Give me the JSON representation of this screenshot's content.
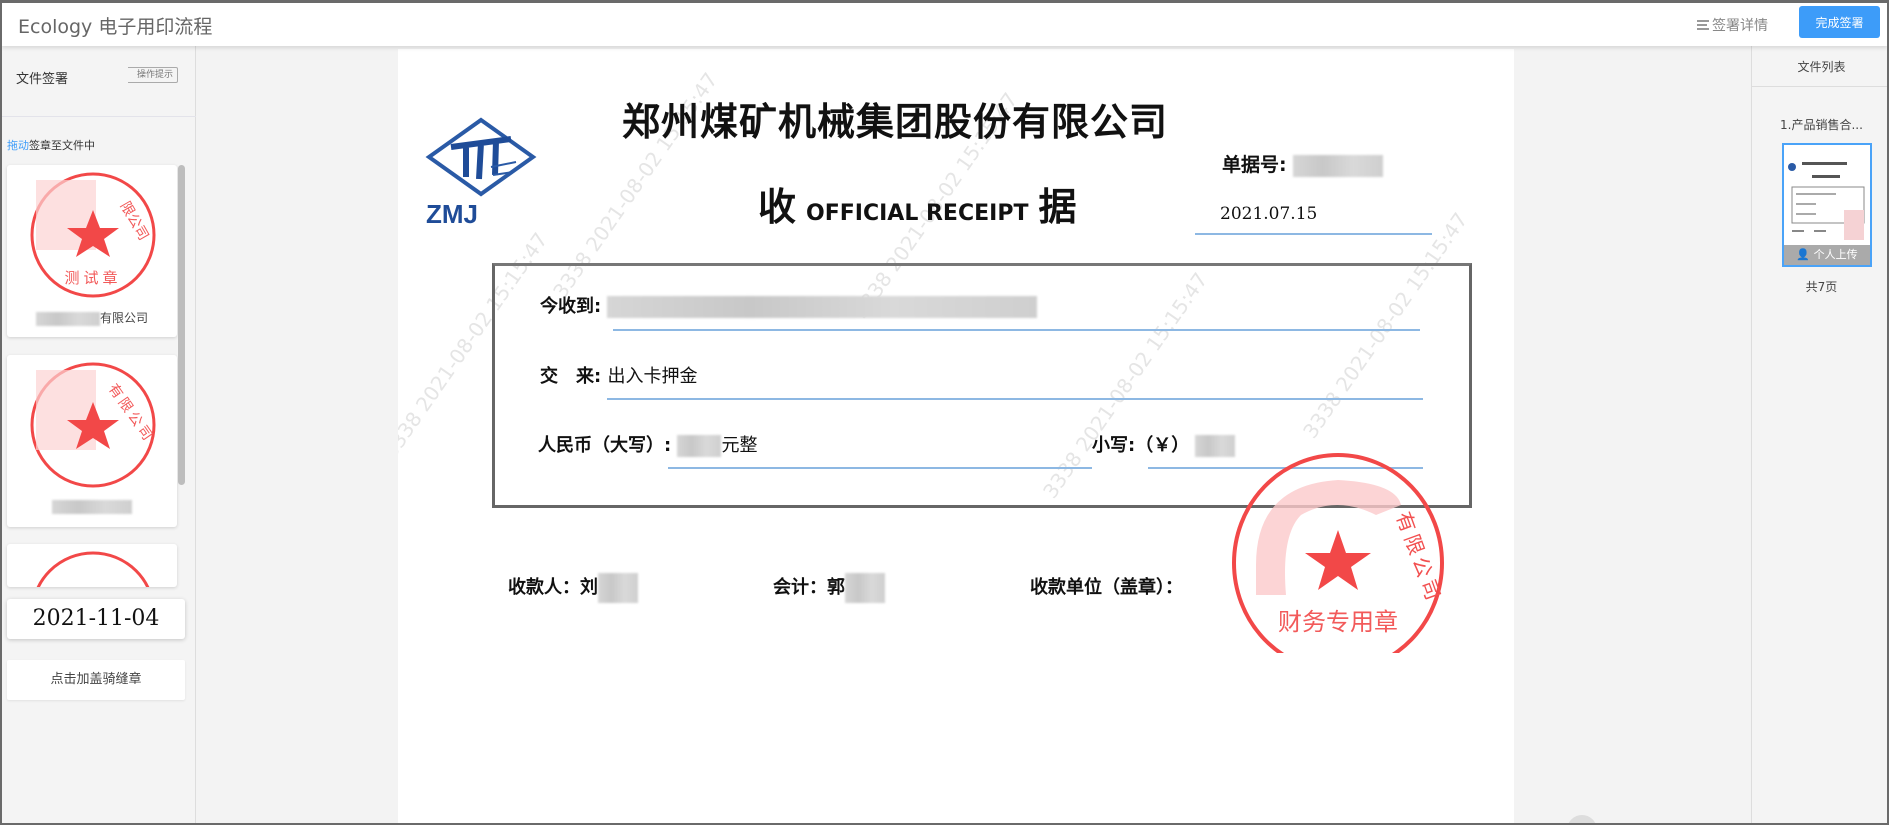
{
  "header": {
    "title": "Ecology 电子用印流程",
    "details_label": "签署详情",
    "finish_label": "完成签署"
  },
  "left_panel": {
    "title": "文件签署",
    "hint_label": "操作提示",
    "drag_tip_link": "拖动",
    "drag_tip_rest": "签章至文件中",
    "stamps": [
      {
        "arc_text": "限公司",
        "center_text": "测试章",
        "label": "有限公司"
      },
      {
        "arc_text": "有限公司",
        "center_text": "",
        "label": ""
      },
      {
        "arc_text": "",
        "center_text": "",
        "label": ""
      }
    ],
    "date_stamp": "2021-11-04",
    "seam_button": "点击加盖骑缝章"
  },
  "document": {
    "company": "郑州煤矿机械集团股份有限公司",
    "logo_text": "ZMJ",
    "receipt_no_label": "单据号:",
    "title_left": "收",
    "title_en": "OFFICIAL RECEIPT",
    "title_right": "据",
    "date": "2021.07.15",
    "received_from_label": "今收到:",
    "for_label": "交　来:",
    "for_value": "出入卡押金",
    "rmb_upper_label": "人民币（大写）:",
    "rmb_upper_suffix": "元整",
    "rmb_lower_label": "小写:（￥）",
    "payee_label": "收款人：刘",
    "accountant_label": "会计：郭",
    "unit_label": "收款单位（盖章）：",
    "seal_arc_text": "有限公司",
    "seal_bottom_text": "财务专用章",
    "watermark": "3338 2021-08-02 15:15:47"
  },
  "right_panel": {
    "title": "文件列表",
    "file_name": "1.产品销售合...",
    "thumb_badge": "个人上传",
    "page_count": "共7页"
  },
  "colors": {
    "accent": "#3d9cf9",
    "seal": "#f24848"
  }
}
